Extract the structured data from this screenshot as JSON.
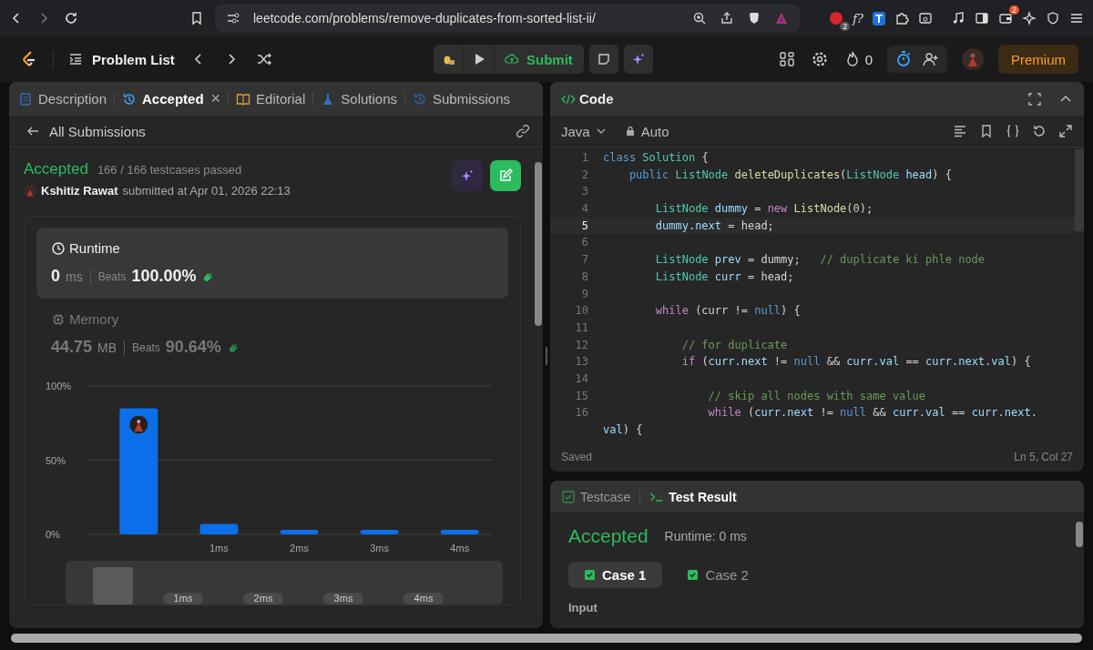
{
  "browser": {
    "url": "leetcode.com/problems/remove-duplicates-from-sorted-list-ii/",
    "extension_badges": [
      "2",
      "2"
    ],
    "extension_texts": [
      "f?",
      "T"
    ]
  },
  "nav": {
    "problem_list": "Problem List",
    "submit": "Submit",
    "streak": "0",
    "premium": "Premium"
  },
  "left_tabs": [
    {
      "label": "Description",
      "selected": false,
      "closable": false
    },
    {
      "label": "Accepted",
      "selected": true,
      "closable": true
    },
    {
      "label": "Editorial",
      "selected": false,
      "closable": false
    },
    {
      "label": "Solutions",
      "selected": false,
      "closable": false
    },
    {
      "label": "Submissions",
      "selected": false,
      "closable": false
    }
  ],
  "close_glyph": "×",
  "back_label": "All Submissions",
  "submission": {
    "status": "Accepted",
    "testcases": "166 / 166 testcases passed",
    "user": "Kshitiz Rawat",
    "submitted": "submitted at Apr 01, 2026 22:13"
  },
  "stats": [
    {
      "kind": "runtime",
      "title": "Runtime",
      "value": "0",
      "unit": "ms",
      "beats_label": "Beats",
      "beats": "100.00%",
      "selected": true
    },
    {
      "kind": "memory",
      "title": "Memory",
      "value": "44.75",
      "unit": "MB",
      "beats_label": "Beats",
      "beats": "90.64%",
      "selected": false
    }
  ],
  "chart_data": {
    "type": "bar",
    "x": [
      0,
      1,
      2,
      3,
      4
    ],
    "values": [
      85,
      7,
      3,
      3,
      3
    ],
    "xlim": [
      -0.65,
      4.4
    ],
    "ylim": [
      0,
      100
    ],
    "xticks": [
      {
        "value": 1,
        "label": "1ms"
      },
      {
        "value": 2,
        "label": "2ms"
      },
      {
        "value": 3,
        "label": "3ms"
      },
      {
        "value": 4,
        "label": "4ms"
      }
    ],
    "yticks": [
      {
        "value": 0,
        "label": "0%"
      },
      {
        "value": 50,
        "label": "50%"
      },
      {
        "value": 100,
        "label": "100%"
      }
    ]
  },
  "navigator_labels": [
    "1ms",
    "2ms",
    "3ms",
    "4ms"
  ],
  "code_panel": {
    "title": "Code",
    "language": "Java",
    "mode": "Auto",
    "status": "Saved",
    "cursor": "Ln 5, Col 27"
  },
  "code_lines": [
    {
      "number": "1",
      "current": false,
      "tokens": [
        {
          "kind": "keyword",
          "text": "class "
        },
        {
          "kind": "type",
          "text": "Solution"
        },
        {
          "kind": "plain",
          "text": " {"
        }
      ]
    },
    {
      "number": "2",
      "current": false,
      "tokens": [
        {
          "kind": "keyword",
          "text": "    public "
        },
        {
          "kind": "type",
          "text": "ListNode "
        },
        {
          "kind": "function",
          "text": "deleteDuplicates"
        },
        {
          "kind": "plain",
          "text": "("
        },
        {
          "kind": "type",
          "text": "ListNode "
        },
        {
          "kind": "variable",
          "text": "head"
        },
        {
          "kind": "plain",
          "text": ") {"
        }
      ]
    },
    {
      "number": "3",
      "current": false
    },
    {
      "number": "4",
      "current": false,
      "tokens": [
        {
          "kind": "type",
          "text": "        ListNode "
        },
        {
          "kind": "variable",
          "text": "dummy"
        },
        {
          "kind": "plain",
          "text": " = "
        },
        {
          "kind": "control",
          "text": "new "
        },
        {
          "kind": "function",
          "text": "ListNode"
        },
        {
          "kind": "plain",
          "text": "("
        },
        {
          "kind": "number",
          "text": "0"
        },
        {
          "kind": "plain",
          "text": ");"
        }
      ]
    },
    {
      "number": "5",
      "current": true,
      "tokens": [
        {
          "kind": "variable",
          "text": "        dummy.next"
        },
        {
          "kind": "plain",
          "text": " = head;"
        }
      ]
    },
    {
      "number": "6",
      "current": false
    },
    {
      "number": "7",
      "current": false,
      "tokens": [
        {
          "kind": "type",
          "text": "        ListNode "
        },
        {
          "kind": "variable",
          "text": "prev"
        },
        {
          "kind": "plain",
          "text": " = dummy;   "
        },
        {
          "kind": "comment",
          "text": "// duplicate ki phle node"
        }
      ]
    },
    {
      "number": "8",
      "current": false,
      "tokens": [
        {
          "kind": "type",
          "text": "        ListNode "
        },
        {
          "kind": "variable",
          "text": "curr"
        },
        {
          "kind": "plain",
          "text": " = head;"
        }
      ]
    },
    {
      "number": "9",
      "current": false
    },
    {
      "number": "10",
      "current": false,
      "tokens": [
        {
          "kind": "control",
          "text": "        while"
        },
        {
          "kind": "plain",
          "text": " (curr != "
        },
        {
          "kind": "keyword",
          "text": "null"
        },
        {
          "kind": "plain",
          "text": ") {"
        }
      ]
    },
    {
      "number": "11",
      "current": false
    },
    {
      "number": "12",
      "current": false,
      "tokens": [
        {
          "kind": "comment",
          "text": "            // for duplicate"
        }
      ]
    },
    {
      "number": "13",
      "current": false,
      "tokens": [
        {
          "kind": "control",
          "text": "            if"
        },
        {
          "kind": "plain",
          "text": " ("
        },
        {
          "kind": "variable",
          "text": "curr.next"
        },
        {
          "kind": "plain",
          "text": " != "
        },
        {
          "kind": "keyword",
          "text": "null"
        },
        {
          "kind": "plain",
          "text": " && "
        },
        {
          "kind": "variable",
          "text": "curr.val"
        },
        {
          "kind": "plain",
          "text": " == "
        },
        {
          "kind": "variable",
          "text": "curr.next.val"
        },
        {
          "kind": "plain",
          "text": ") {"
        }
      ]
    },
    {
      "number": "14",
      "current": false
    },
    {
      "number": "15",
      "current": false,
      "tokens": [
        {
          "kind": "comment",
          "text": "                // skip all nodes with same value"
        }
      ]
    },
    {
      "number": "16",
      "current": false,
      "tokens": [
        {
          "kind": "control",
          "text": "                while"
        },
        {
          "kind": "plain",
          "text": " ("
        },
        {
          "kind": "variable",
          "text": "curr.next"
        },
        {
          "kind": "plain",
          "text": " != "
        },
        {
          "kind": "keyword",
          "text": "null"
        },
        {
          "kind": "plain",
          "text": " && "
        },
        {
          "kind": "variable",
          "text": "curr.val"
        },
        {
          "kind": "plain",
          "text": " == "
        },
        {
          "kind": "variable",
          "text": "curr.next."
        }
      ],
      "continuation": [
        {
          "kind": "variable",
          "text": "val"
        },
        {
          "kind": "plain",
          "text": ") {"
        }
      ]
    }
  ],
  "result_tabs": [
    {
      "label": "Testcase",
      "selected": false
    },
    {
      "label": "Test Result",
      "selected": true
    }
  ],
  "result": {
    "status": "Accepted",
    "runtime": "Runtime: 0 ms",
    "input_label": "Input"
  },
  "cases": [
    {
      "label": "Case 1",
      "selected": true
    },
    {
      "label": "Case 2",
      "selected": false
    }
  ]
}
